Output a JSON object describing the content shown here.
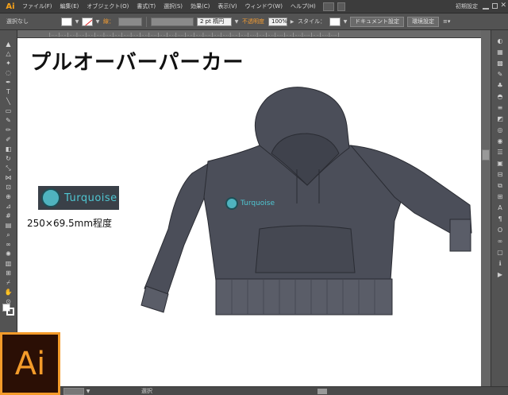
{
  "app": {
    "mini_logo": "Ai",
    "workspace": "初期設定",
    "product_logo": "Ai"
  },
  "menu": {
    "items": [
      "ファイル(F)",
      "編集(E)",
      "オブジェクト(O)",
      "書式(T)",
      "選択(S)",
      "効果(C)",
      "表示(V)",
      "ウィンドウ(W)",
      "ヘルプ(H)"
    ]
  },
  "control_bar": {
    "selection_status": "選択なし",
    "stroke_label": "線：",
    "stroke_weight": "2 pt 楕円",
    "opacity_label": "不透明度",
    "opacity_value": "100%",
    "style_label": "スタイル：",
    "document_setup": "ドキュメント設定",
    "preferences": "環境設定"
  },
  "tools": [
    "selection-tool",
    "direct-selection-tool",
    "magic-wand-tool",
    "lasso-tool",
    "pen-tool",
    "type-tool",
    "line-tool",
    "rectangle-tool",
    "paintbrush-tool",
    "pencil-tool",
    "blob-brush-tool",
    "eraser-tool",
    "rotate-tool",
    "scale-tool",
    "width-tool",
    "free-transform-tool",
    "shape-builder-tool",
    "perspective-grid-tool",
    "mesh-tool",
    "gradient-tool",
    "eyedropper-tool",
    "blend-tool",
    "symbol-sprayer-tool",
    "graph-tool",
    "artboard-tool",
    "slice-tool",
    "hand-tool",
    "zoom-tool"
  ],
  "panels": [
    "color-panel-icon",
    "color-guide-icon",
    "swatches-icon",
    "brushes-icon",
    "symbols-icon",
    "graphic-styles-icon",
    "stroke-icon",
    "gradient-icon",
    "transparency-icon",
    "appearance-icon",
    "layers-icon",
    "artboards-icon",
    "align-icon",
    "pathfinder-icon",
    "transform-icon",
    "character-icon",
    "paragraph-icon",
    "opentype-icon",
    "links-icon",
    "navigator-icon",
    "info-icon",
    "actions-icon"
  ],
  "artwork": {
    "title": "プルオーバーパーカー",
    "logo_text": "Turquoise",
    "size_note": "250×69.5mm程度",
    "hoodie_color": "#4b4e59",
    "hoodie_outline": "#2a2c33",
    "logo_color": "#4fc6d2"
  },
  "status_bar": {
    "mode": "選択"
  },
  "colors": {
    "accent": "#f49b2a",
    "ui_dark": "#535353",
    "canvas": "#ffffff"
  }
}
